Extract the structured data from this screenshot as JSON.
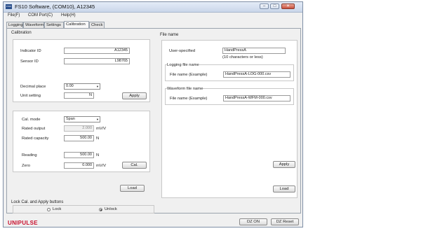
{
  "window": {
    "title": "FS10 Software, (COM10), A12345",
    "icon_text": "FS10"
  },
  "menu": [
    "File(F)",
    "COM Port(C)",
    "Help(H)"
  ],
  "tabs": [
    "Logging",
    "Waveform",
    "Settings",
    "Calibration",
    "Check"
  ],
  "active_tab": "Calibration",
  "calibration": {
    "title": "Calibration",
    "indicator_id_label": "Indicator ID",
    "indicator_id": "A12345",
    "sensor_id_label": "Sensor ID",
    "sensor_id": "L98765",
    "decimal_place_label": "Decimal place",
    "decimal_place": "0.00",
    "unit_setting_label": "Unit setting",
    "unit_setting": "N",
    "apply_label": "Apply",
    "cal_mode_label": "Cal. mode",
    "cal_mode": "Span",
    "rated_output_label": "Rated output",
    "rated_output": "2.000",
    "rated_output_unit": "mV/V",
    "rated_capacity_label": "Rated capacity",
    "rated_capacity": "500.00",
    "rated_capacity_unit": "N",
    "reading_label": "Reading",
    "reading": "500.00",
    "reading_unit": "N",
    "zero_label": "Zero",
    "zero": "0.000",
    "zero_unit": "mV/V",
    "cal_button_label": "Cal.",
    "load_label": "Load"
  },
  "lock": {
    "title": "Lock Cal. and Apply buttons",
    "lock_label": "Lock",
    "unlock_label": "Unlock",
    "selected": "Unlock"
  },
  "file_name": {
    "title": "File name",
    "user_specified_label": "User-specified",
    "user_specified": "HandPressA",
    "hint": "(10 characters or less)",
    "logging_title": "Logging file name",
    "logging_example_label": "File name (Example)",
    "logging_example": "HandPressA-LOG-000.csv",
    "waveform_title": "Waveform file name",
    "waveform_example_label": "File name (Example)",
    "waveform_example": "HandPressA-WFM-000.csv",
    "apply_label": "Apply",
    "load_label": "Load"
  },
  "footer": {
    "logo": "UNIPULSE",
    "dz_on_label": "DZ ON",
    "dz_reset_label": "DZ Reset"
  }
}
